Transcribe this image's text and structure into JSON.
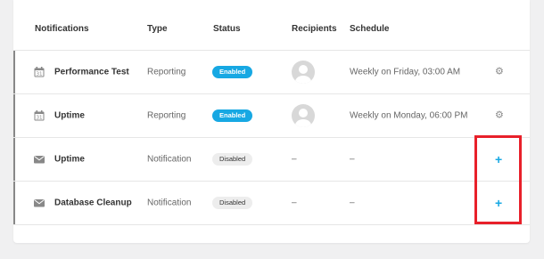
{
  "headers": {
    "notifications": "Notifications",
    "type": "Type",
    "status": "Status",
    "recipients": "Recipients",
    "schedule": "Schedule"
  },
  "rows": [
    {
      "name": "Performance Test",
      "icon": "calendar-icon",
      "type": "Reporting",
      "status": "Enabled",
      "recipients": "avatar",
      "schedule": "Weekly on Friday, 03:00 AM",
      "action": "settings"
    },
    {
      "name": "Uptime",
      "icon": "calendar-icon",
      "type": "Reporting",
      "status": "Enabled",
      "recipients": "avatar",
      "schedule": "Weekly on Monday, 06:00 PM",
      "action": "settings"
    },
    {
      "name": "Uptime",
      "icon": "envelope-icon",
      "type": "Notification",
      "status": "Disabled",
      "recipients": "–",
      "schedule": "–",
      "action": "+"
    },
    {
      "name": "Database Cleanup",
      "icon": "envelope-icon",
      "type": "Notification",
      "status": "Disabled",
      "recipients": "–",
      "schedule": "–",
      "action": "+"
    }
  ],
  "colors": {
    "accent": "#17a8e3",
    "highlight": "#e8202a",
    "disabled_bg": "#ededed"
  }
}
